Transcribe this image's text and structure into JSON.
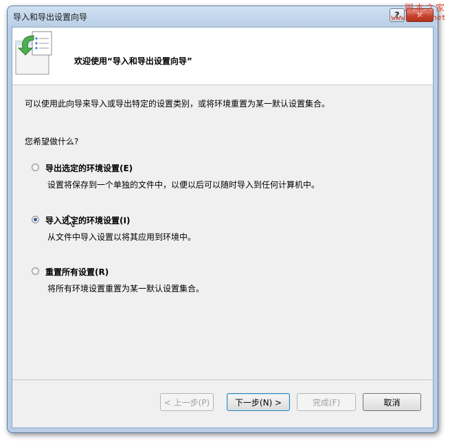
{
  "window": {
    "title": "导入和导出设置向导",
    "help_label": "?",
    "close_label": "✕"
  },
  "header": {
    "title": "欢迎使用“导入和导出设置向导”",
    "icon": "import-export-wizard-icon"
  },
  "body": {
    "description": "可以使用此向导来导入或导出特定的设置类别，或将环境重置为某一默认设置集合。",
    "question": "您希望做什么?"
  },
  "options": [
    {
      "label": "导出选定的环境设置(E)",
      "description": "设置将保存到一个单独的文件中，以便以后可以随时导入到任何计算机中。",
      "checked": false
    },
    {
      "label": "导入选定的环境设置(I)",
      "description": "从文件中导入设置以将其应用到环境中。",
      "checked": true
    },
    {
      "label": "重置所有设置(R)",
      "description": "将所有环境设置重置为某一默认设置集合。",
      "checked": false
    }
  ],
  "buttons": {
    "back": "< 上一步(P)",
    "next": "下一步(N) >",
    "finish": "完成(F)",
    "cancel": "取消"
  },
  "watermark": {
    "line1": "脚本之家",
    "line2": "www.jb51.net"
  }
}
